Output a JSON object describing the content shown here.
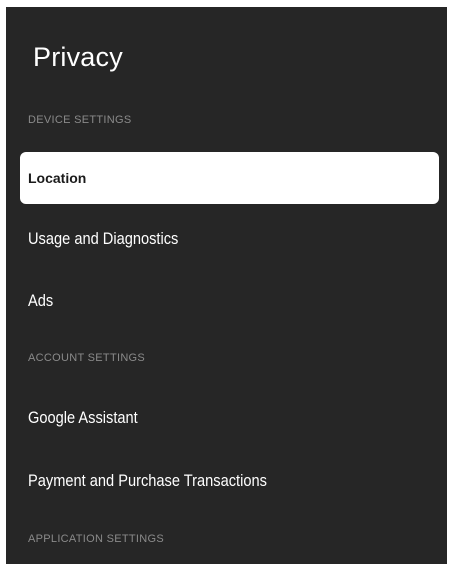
{
  "page": {
    "title": "Privacy"
  },
  "sections": {
    "device": {
      "header": "DEVICE SETTINGS",
      "items": [
        "Location",
        "Usage and Diagnostics",
        "Ads"
      ]
    },
    "account": {
      "header": "ACCOUNT SETTINGS",
      "items": [
        "Google Assistant",
        "Payment and Purchase Transactions"
      ]
    },
    "application": {
      "header": "APPLICATION SETTINGS"
    }
  },
  "selected_item": "Location",
  "colors": {
    "panel_background": "#262626",
    "selected_background": "#ffffff",
    "header_text": "#8a8a8a",
    "item_text": "#ffffff"
  }
}
